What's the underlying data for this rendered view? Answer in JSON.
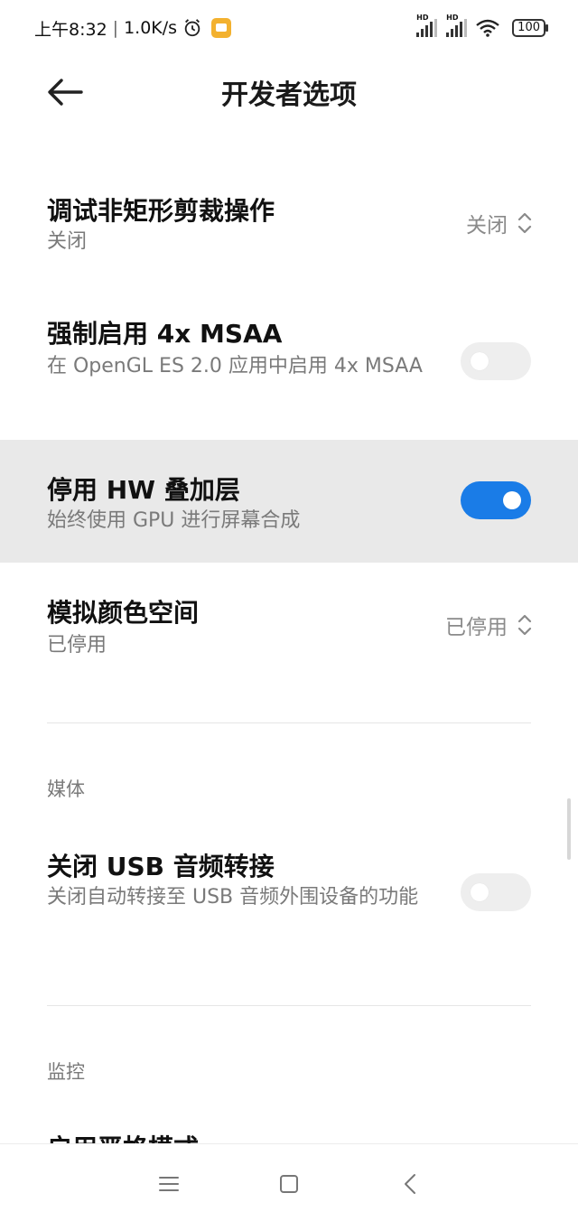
{
  "status_bar": {
    "time": "上午8:32",
    "speed": "1.0K/s",
    "separator": "|",
    "signal_label": "HD",
    "battery": "100"
  },
  "header": {
    "title": "开发者选项",
    "back_icon": "back-arrow-icon"
  },
  "settings": [
    {
      "title": "调试非矩形剪裁操作",
      "subtitle": "关闭",
      "control": "select",
      "value": "关闭"
    },
    {
      "title": "强制启用 4x MSAA",
      "subtitle": "在 OpenGL ES 2.0 应用中启用 4x MSAA",
      "control": "switch",
      "on": false
    },
    {
      "title": "停用 HW 叠加层",
      "subtitle": "始终使用 GPU 进行屏幕合成",
      "control": "switch",
      "on": true,
      "highlighted": true
    },
    {
      "title": "模拟颜色空间",
      "subtitle": "已停用",
      "control": "select",
      "value": "已停用"
    }
  ],
  "sections": {
    "media": {
      "label": "媒体",
      "items": [
        {
          "title": "关闭 USB 音频转接",
          "subtitle": "关闭自动转接至 USB 音频外围设备的功能",
          "control": "switch",
          "on": false
        }
      ]
    },
    "monitor": {
      "label": "监控",
      "items": [
        {
          "title": "启用严格模式"
        }
      ]
    }
  },
  "colors": {
    "accent": "#1a7ce7",
    "highlight_row": "#e9e9e9",
    "switch_off": "#eeeeee",
    "secondary_text": "#7a7a7a"
  },
  "navbar": {
    "icons": [
      "menu-icon",
      "home-square-icon",
      "back-chevron-icon"
    ]
  }
}
